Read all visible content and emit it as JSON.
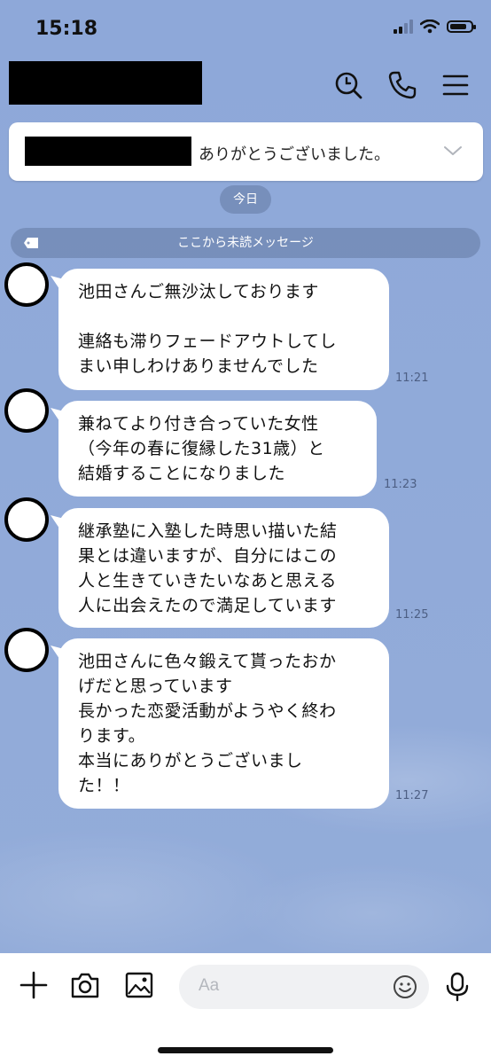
{
  "status_bar": {
    "time": "15:18"
  },
  "header": {
    "icons": [
      "search-icon",
      "phone-icon",
      "menu-icon"
    ]
  },
  "announcement": {
    "text": "ありがとうございました。",
    "expand_icon": "chevron-down-icon"
  },
  "date_divider": "今日",
  "unread_divider": "ここから未読メッセージ",
  "messages": [
    {
      "text": "池田さんご無沙汰しております\n\n連絡も滞りフェードアウトしてし\nまい申しわけありませんでした",
      "time": "11:21"
    },
    {
      "text": "兼ねてより付き合っていた女性\n（今年の春に復縁した31歳）と\n結婚することになりました",
      "time": "11:23"
    },
    {
      "text": "継承塾に入塾した時思い描いた結\n果とは違いますが、自分にはこの\n人と生きていきたいなあと思える\n人に出会えたので満足しています",
      "time": "11:25"
    },
    {
      "text": "池田さんに色々鍛えて貰ったおか\nげだと思っています\n長かった恋愛活動がようやく終わ\nります。\n本当にありがとうございまし\nた！！",
      "time": "11:27"
    }
  ],
  "composer": {
    "placeholder": "Aa",
    "icons": [
      "plus-icon",
      "camera-icon",
      "image-icon",
      "emoji-icon",
      "microphone-icon"
    ]
  },
  "colors": {
    "background": "#8fa9d9",
    "bubble": "#ffffff",
    "accent_text": "#4d5f84"
  }
}
